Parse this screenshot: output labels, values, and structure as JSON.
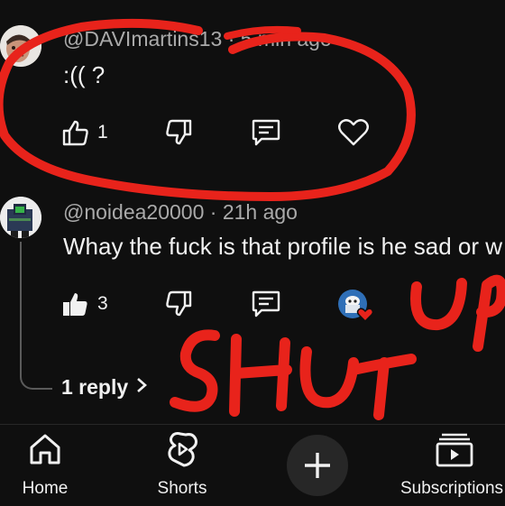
{
  "comments": [
    {
      "handle": "@DAVImartins13 · 5 min ago",
      "text": ":(( ?",
      "likes": "1"
    },
    {
      "handle": "@noidea20000 · 21h ago",
      "text": "Whay the fuck is that profile is he sad or w",
      "likes": "3",
      "replies_label": "1 reply"
    }
  ],
  "nav": {
    "home": "Home",
    "shorts": "Shorts",
    "subscriptions": "Subscriptions"
  },
  "annotation": {
    "text": "SHUTUP",
    "color": "#e8231b"
  },
  "colors": {
    "background": "#0f0f0f",
    "text": "#f1f1f1",
    "muted": "#aaaaaa",
    "heart_badge": "#e8231b"
  }
}
